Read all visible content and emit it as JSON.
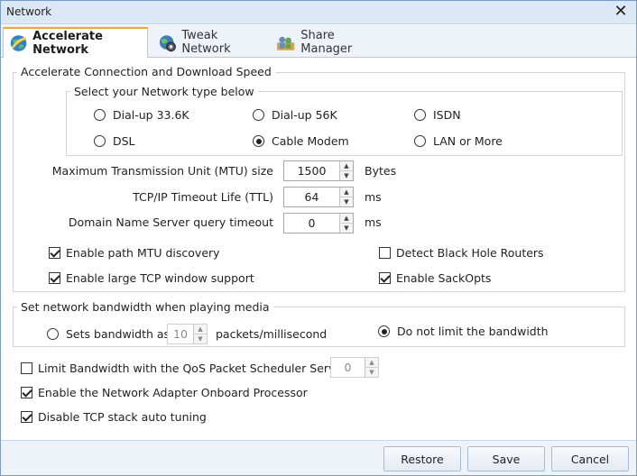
{
  "window": {
    "title": "Network",
    "close_glyph": "✕"
  },
  "tabs": [
    {
      "label": "Accelerate Network",
      "icon": "globe-icon",
      "active": true
    },
    {
      "label": "Tweak Network",
      "icon": "gear-globe-icon",
      "active": false
    },
    {
      "label": "Share Manager",
      "icon": "users-icon",
      "active": false
    }
  ],
  "accelerate": {
    "legend": "Accelerate Connection and Download Speed",
    "network_type": {
      "legend": "Select your Network type below",
      "options": [
        {
          "label": "Dial-up 33.6K",
          "selected": false
        },
        {
          "label": "Dial-up 56K",
          "selected": false
        },
        {
          "label": "ISDN",
          "selected": false
        },
        {
          "label": "DSL",
          "selected": false
        },
        {
          "label": "Cable Modem",
          "selected": true
        },
        {
          "label": "LAN or More",
          "selected": false
        }
      ]
    },
    "mtu": {
      "label": "Maximum Transmission Unit (MTU) size",
      "value": "1500",
      "unit": "Bytes"
    },
    "ttl": {
      "label": "TCP/IP Timeout Life (TTL)",
      "value": "64",
      "unit": "ms"
    },
    "dns": {
      "label": "Domain Name Server query timeout",
      "value": "0",
      "unit": "ms"
    },
    "checks": [
      {
        "label": "Enable path MTU discovery",
        "checked": true
      },
      {
        "label": "Detect Black Hole Routers",
        "checked": false
      },
      {
        "label": "Enable large TCP window support",
        "checked": true
      },
      {
        "label": "Enable SackOpts",
        "checked": true
      }
    ]
  },
  "bandwidth": {
    "legend": "Set network bandwidth when playing media",
    "sets_label": "Sets bandwidth as",
    "sets_value": "10",
    "sets_unit": "packets/millisecond",
    "sets_selected": false,
    "nolimit_label": "Do not limit the bandwidth",
    "nolimit_selected": true
  },
  "bottom_checks": {
    "qos_label": "Limit Bandwidth with the QoS Packet Scheduler Service",
    "qos_checked": false,
    "qos_value": "0",
    "adapter_label": "Enable the Network Adapter Onboard Processor",
    "adapter_checked": true,
    "tcp_label": "Disable TCP stack auto tuning",
    "tcp_checked": true
  },
  "footer": {
    "restore": "Restore",
    "save": "Save",
    "cancel": "Cancel"
  },
  "spin_up": "▲",
  "spin_down": "▼",
  "colors": {
    "tab_accent": "#f2a33a",
    "title_bg": "#dde8f6",
    "footer_bg": "#eef3fa"
  }
}
